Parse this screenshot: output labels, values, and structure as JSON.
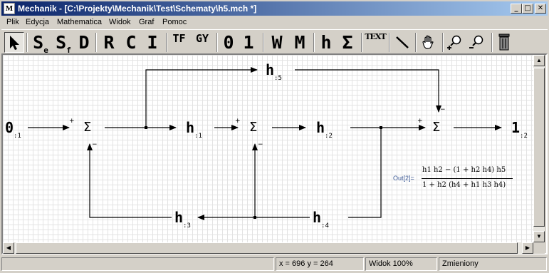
{
  "window": {
    "title": "Mechanik - [C:\\Projekty\\Mechanik\\Test\\Schematy\\h5.mch *]",
    "app_icon_letter": "M",
    "minimize": "_",
    "maximize": "□",
    "close": "✕"
  },
  "menu": [
    "Plik",
    "Edycja",
    "Mathematica",
    "Widok",
    "Graf",
    "Pomoc"
  ],
  "toolbar": {
    "select": "select-arrow",
    "se_main": "S",
    "se_sub": "e",
    "sf_main": "S",
    "sf_sub": "f",
    "d": "D",
    "r": "R",
    "c": "C",
    "i": "I",
    "tf": "TF",
    "gy": "GY",
    "zero": "0",
    "one": "1",
    "w": "W",
    "m": "M",
    "h": "h",
    "sigma": "Σ",
    "text": "TEXT",
    "line": "line-tool",
    "hand": "hand-tool",
    "zoom_in": "zoom-in",
    "zoom_out": "zoom-out",
    "trash": "delete"
  },
  "diagram": {
    "source": {
      "name": "0",
      "sub": ":1"
    },
    "sum1": "Σ",
    "h1": {
      "name": "h",
      "sub": ":1"
    },
    "sum2": "Σ",
    "h2": {
      "name": "h",
      "sub": ":2"
    },
    "sum3": "Σ",
    "output": {
      "name": "1",
      "sub": ":2"
    },
    "h5": {
      "name": "h",
      "sub": ":5"
    },
    "h3": {
      "name": "h",
      "sub": ":3"
    },
    "h4": {
      "name": "h",
      "sub": ":4"
    },
    "signs": {
      "sum1_in": "+",
      "sum1_fb": "−",
      "sum2_in": "+",
      "sum2_fb": "−",
      "sum3_in": "+",
      "sum3_top": "−"
    }
  },
  "formula": {
    "label": "Out[2]=",
    "numerator": "h1 h2 − (1 + h2 h4) h5",
    "denominator": "1 + h2 (h4 + h1 h3 h4)"
  },
  "statusbar": {
    "coords": "x = 696 y = 264",
    "zoom": "Widok 100%",
    "state": "Zmieniony"
  }
}
